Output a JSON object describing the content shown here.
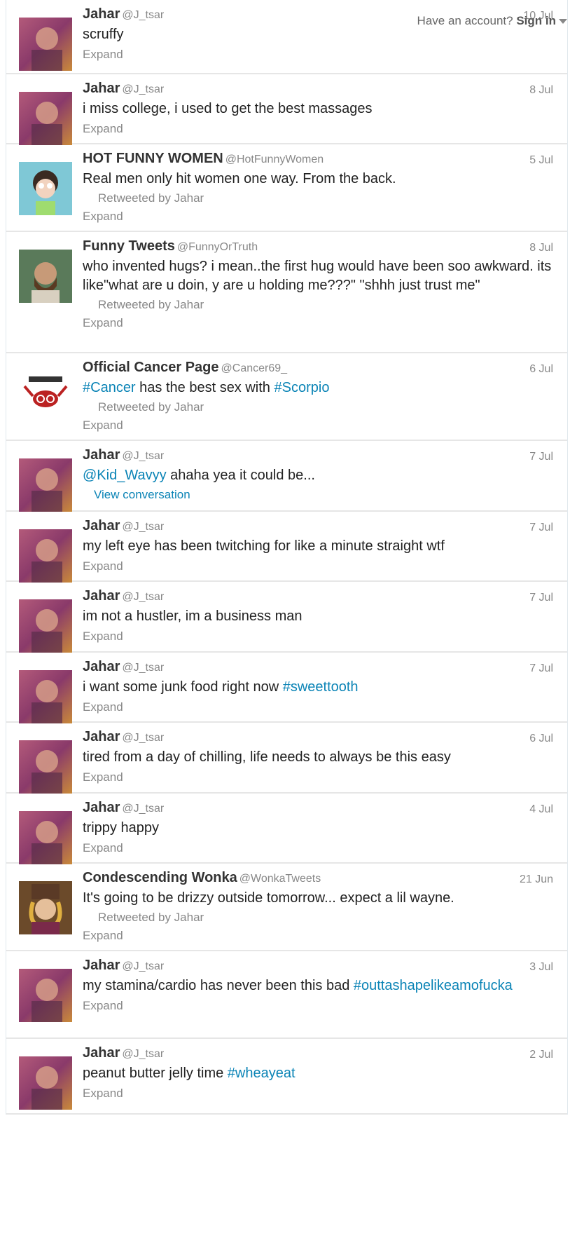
{
  "topbar": {
    "have_account": "Have an account?",
    "sign_in": "Sign in"
  },
  "tweets": [
    {
      "name": "Jahar",
      "handle": "@J_tsar",
      "time": "10 Jul",
      "text": [
        {
          "t": "scruffy"
        }
      ],
      "retweeted": null,
      "action": "Expand",
      "avatar": "jahar"
    },
    {
      "name": "Jahar",
      "handle": "@J_tsar",
      "time": "8 Jul",
      "text": [
        {
          "t": "i miss college, i used to get the best massages"
        }
      ],
      "retweeted": null,
      "action": "Expand",
      "avatar": "jahar"
    },
    {
      "name": "HOT FUNNY WOMEN",
      "handle": "@HotFunnyWomen",
      "time": "5 Jul",
      "text": [
        {
          "t": "Real men only hit women one way. From the back."
        }
      ],
      "retweeted": "Retweeted by Jahar",
      "action": "Expand",
      "avatar": "woman"
    },
    {
      "name": "Funny Tweets",
      "handle": "@FunnyOrTruth",
      "time": "8 Jul",
      "text": [
        {
          "t": "who invented hugs? i mean..the first hug would have been soo awkward. its like\"what are u doin, y are u holding me???\" \"shhh just trust me\""
        }
      ],
      "retweeted": "Retweeted by Jahar",
      "action": "Expand",
      "avatar": "man"
    },
    {
      "name": "Official Cancer Page",
      "handle": "@Cancer69_",
      "time": "6 Jul",
      "text": [
        {
          "t": "#Cancer",
          "link": true
        },
        {
          "t": " has the best sex with "
        },
        {
          "t": "#Scorpio",
          "link": true
        }
      ],
      "retweeted": "Retweeted by Jahar",
      "action": "Expand",
      "avatar": "crab"
    },
    {
      "name": "Jahar",
      "handle": "@J_tsar",
      "time": "7 Jul",
      "text": [
        {
          "t": "@Kid_Wavyy",
          "link": true
        },
        {
          "t": " ahaha yea it could be..."
        }
      ],
      "retweeted": null,
      "action": "View conversation",
      "avatar": "jahar"
    },
    {
      "name": "Jahar",
      "handle": "@J_tsar",
      "time": "7 Jul",
      "text": [
        {
          "t": "my left eye has been twitching for like a minute straight wtf"
        }
      ],
      "retweeted": null,
      "action": "Expand",
      "avatar": "jahar"
    },
    {
      "name": "Jahar",
      "handle": "@J_tsar",
      "time": "7 Jul",
      "text": [
        {
          "t": "im not a hustler, im a business man"
        }
      ],
      "retweeted": null,
      "action": "Expand",
      "avatar": "jahar"
    },
    {
      "name": "Jahar",
      "handle": "@J_tsar",
      "time": "7 Jul",
      "text": [
        {
          "t": "i want some junk food right now "
        },
        {
          "t": "#sweettooth",
          "link": true
        }
      ],
      "retweeted": null,
      "action": "Expand",
      "avatar": "jahar"
    },
    {
      "name": "Jahar",
      "handle": "@J_tsar",
      "time": "6 Jul",
      "text": [
        {
          "t": "tired from a day of chilling, life needs to always be this easy"
        }
      ],
      "retweeted": null,
      "action": "Expand",
      "avatar": "jahar"
    },
    {
      "name": "Jahar",
      "handle": "@J_tsar",
      "time": "4 Jul",
      "text": [
        {
          "t": "trippy happy"
        }
      ],
      "retweeted": null,
      "action": "Expand",
      "avatar": "jahar"
    },
    {
      "name": "Condescending Wonka",
      "handle": "@WonkaTweets",
      "time": "21 Jun",
      "text": [
        {
          "t": "It's going to be drizzy outside tomorrow... expect a lil wayne."
        }
      ],
      "retweeted": "Retweeted by Jahar",
      "action": "Expand",
      "avatar": "wonka"
    },
    {
      "name": "Jahar",
      "handle": "@J_tsar",
      "time": "3 Jul",
      "text": [
        {
          "t": "my stamina/cardio has never been this bad "
        },
        {
          "t": "#outtashapelikeamofucka",
          "link": true
        }
      ],
      "retweeted": null,
      "action": "Expand",
      "avatar": "jahar"
    },
    {
      "name": "Jahar",
      "handle": "@J_tsar",
      "time": "2 Jul",
      "text": [
        {
          "t": "peanut butter jelly time "
        },
        {
          "t": "#wheayeat",
          "link": true
        }
      ],
      "retweeted": null,
      "action": "Expand",
      "avatar": "jahar"
    }
  ]
}
